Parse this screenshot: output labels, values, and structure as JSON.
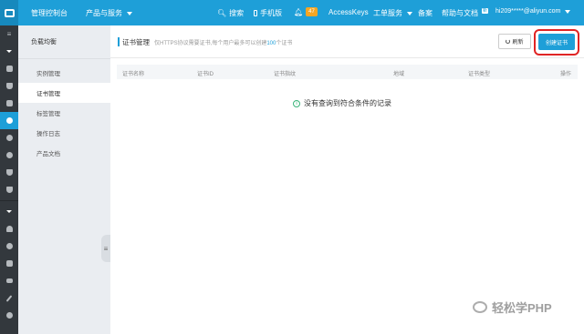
{
  "topbar": {
    "console_label": "管理控制台",
    "products_label": "产品与服务",
    "search_label": "搜索",
    "mobile_label": "手机版",
    "notification_count": "47",
    "accesskeys_label": "AccessKeys",
    "tickets_label": "工单服务",
    "beian_label": "备案",
    "help_label": "帮助与文档",
    "help_badge": "新",
    "user_label": "hi209*****@aliyun.com"
  },
  "subnav": {
    "title": "负载均衡",
    "items": [
      {
        "label": "实例管理"
      },
      {
        "label": "证书管理"
      },
      {
        "label": "标签管理"
      },
      {
        "label": "操作日志"
      },
      {
        "label": "产品文档"
      }
    ]
  },
  "main": {
    "title": "证书管理",
    "description": "仅HTTPS协议需要证书,每个用户最多可以创建",
    "desc_count": "100",
    "desc_suffix": "个证书",
    "refresh_label": "刷新",
    "create_label": "创建证书",
    "columns": [
      "证书名称",
      "证书ID",
      "证书指纹",
      "地域",
      "证书类型",
      "操作"
    ],
    "empty_text": "没有查询到符合条件的记录"
  },
  "watermark": {
    "text": "轻松学PHP"
  },
  "colors": {
    "primary": "#1e9fd8",
    "highlight": "#e02424",
    "rail": "#33383d"
  }
}
